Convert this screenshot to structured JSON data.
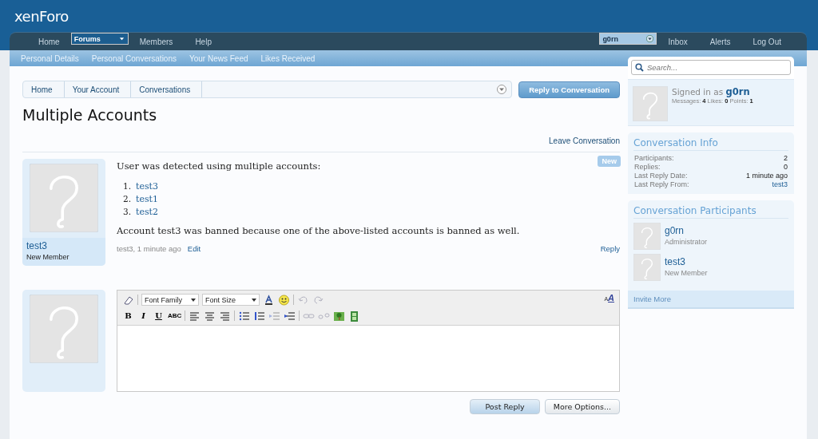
{
  "logo": {
    "text": "xenForo"
  },
  "nav_tabs": [
    {
      "label": "Home",
      "selected": false,
      "dropdown": false
    },
    {
      "label": "Forums",
      "selected": true,
      "dropdown": true
    },
    {
      "label": "Members",
      "selected": false,
      "dropdown": false
    },
    {
      "label": "Help",
      "selected": false,
      "dropdown": false
    }
  ],
  "user_tabs": [
    {
      "label": "g0rn",
      "selected": true,
      "dropdown": true
    },
    {
      "label": "Inbox",
      "selected": false,
      "dropdown": false
    },
    {
      "label": "Alerts",
      "selected": false,
      "dropdown": false
    },
    {
      "label": "Log Out",
      "selected": false,
      "dropdown": false
    }
  ],
  "sub_nav": [
    "Personal Details",
    "Personal Conversations",
    "Your News Feed",
    "Likes Received"
  ],
  "breadcrumb": [
    "Home",
    "Your Account",
    "Conversations"
  ],
  "reply_button": "Reply to Conversation",
  "title": "Multiple Accounts",
  "leave_link": "Leave Conversation",
  "message": {
    "username": "test3",
    "user_title": "New Member",
    "badge": "New",
    "intro": "User was detected using multiple accounts:",
    "accounts": [
      {
        "number": "1.",
        "name": "test3"
      },
      {
        "number": "2.",
        "name": "test1"
      },
      {
        "number": "3.",
        "name": "test2"
      }
    ],
    "outro": "Account test3 was banned because one of the above-listed accounts is banned as well.",
    "meta": "test3, 1 minute ago",
    "edit": "Edit",
    "reply": "Reply"
  },
  "editor": {
    "toolbar_row_1": [
      {
        "kind": "eraser",
        "disabled": false
      },
      {
        "kind": "separator"
      },
      {
        "kind": "select",
        "label": "Font Family"
      },
      {
        "kind": "select",
        "label": "Font Size"
      },
      {
        "kind": "color",
        "disabled": false
      },
      {
        "kind": "smiley",
        "disabled": false
      },
      {
        "kind": "separator"
      },
      {
        "kind": "undo",
        "disabled": true
      },
      {
        "kind": "redo",
        "disabled": true
      }
    ],
    "toolbar_row_2": [
      {
        "kind": "text",
        "label": "B",
        "disabled": false
      },
      {
        "kind": "text",
        "label": "I",
        "disabled": false
      },
      {
        "kind": "text",
        "label": "U",
        "disabled": false
      },
      {
        "kind": "text",
        "label": "ABC",
        "disabled": false
      },
      {
        "kind": "separator"
      },
      {
        "kind": "align-left",
        "disabled": false
      },
      {
        "kind": "align-center",
        "disabled": false
      },
      {
        "kind": "align-right",
        "disabled": false
      },
      {
        "kind": "separator"
      },
      {
        "kind": "bullets",
        "disabled": false
      },
      {
        "kind": "numbers",
        "disabled": false
      },
      {
        "kind": "outdent",
        "disabled": true
      },
      {
        "kind": "indent",
        "disabled": false
      },
      {
        "kind": "separator"
      },
      {
        "kind": "link",
        "disabled": true
      },
      {
        "kind": "unlink",
        "disabled": true
      },
      {
        "kind": "image",
        "disabled": false
      },
      {
        "kind": "media",
        "disabled": false
      }
    ],
    "mode_toggle": {
      "small": "A",
      "large": "A"
    }
  },
  "buttons": [
    {
      "label": "Post Reply",
      "primary": true
    },
    {
      "label": "More Options...",
      "primary": false
    }
  ],
  "sidebar": {
    "search_placeholder": "Search...",
    "signed_in": {
      "prefix": "Signed in as",
      "username": "g0rn",
      "stats": "Messages: **4** Likes: **0** Points: **1**"
    },
    "info": {
      "heading": "Conversation Info",
      "rows": [
        {
          "label": "Participants:",
          "value": "2",
          "link": false
        },
        {
          "label": "Replies:",
          "value": "0",
          "link": false
        },
        {
          "label": "Last Reply Date:",
          "value": "1 minute ago",
          "link": false
        },
        {
          "label": "Last Reply From:",
          "value": "test3",
          "link": true
        }
      ]
    },
    "participants": {
      "heading": "Conversation Participants",
      "items": [
        {
          "name": "g0rn",
          "title": "Administrator"
        },
        {
          "name": "test3",
          "title": "New Member"
        }
      ],
      "footer": "Invite More"
    }
  }
}
